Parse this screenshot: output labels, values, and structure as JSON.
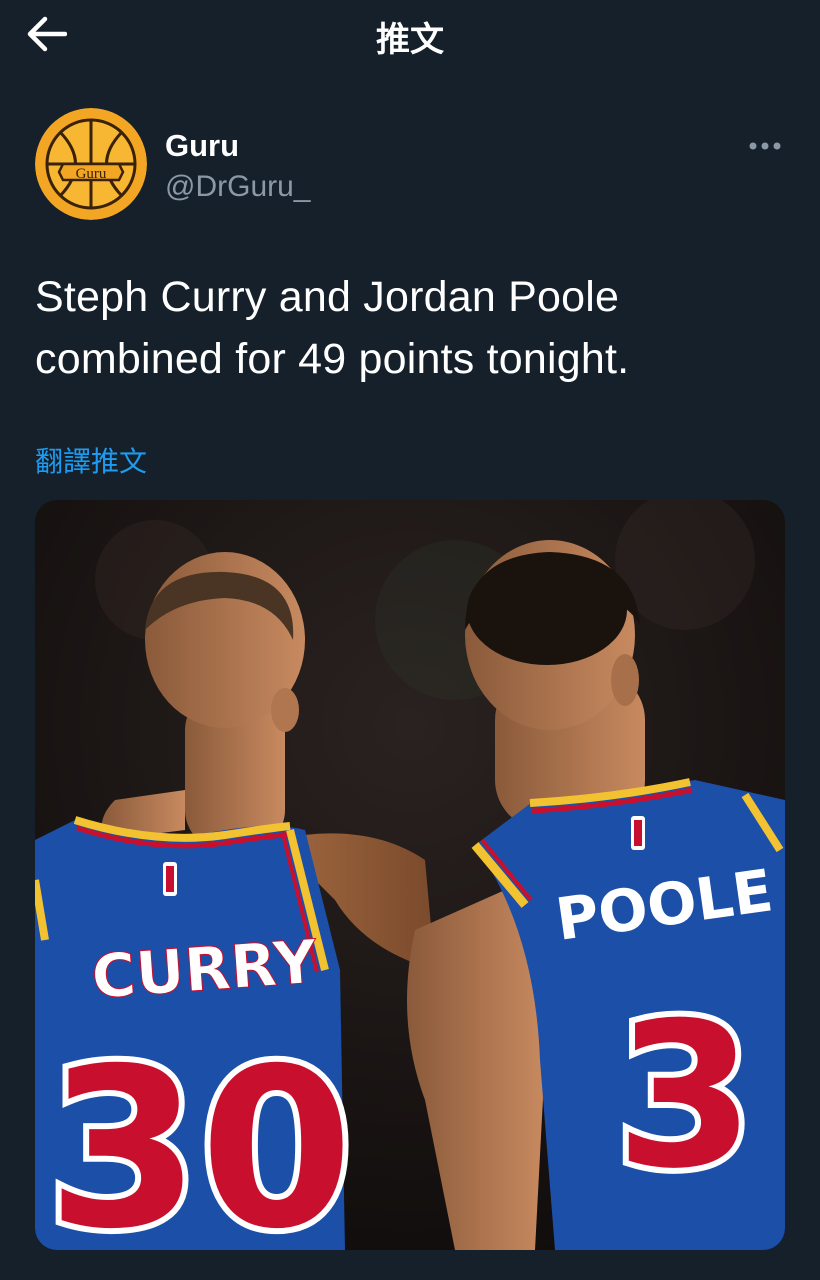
{
  "header": {
    "title": "推文",
    "back_icon": "arrow-left-icon"
  },
  "author": {
    "name": "Guru",
    "handle": "@DrGuru_",
    "avatar_text": "Guru"
  },
  "tweet": {
    "text_line1": "Steph Curry and Jordan Poole",
    "text_line2": "combined for 49 points tonight."
  },
  "translate_label": "翻譯推文",
  "media": {
    "left_player": {
      "name": "CURRY",
      "number": "30"
    },
    "right_player": {
      "name": "POOLE",
      "number": "3"
    }
  },
  "colors": {
    "background": "#15202b",
    "link": "#1d9bf0",
    "secondary_text": "#8b98a5",
    "jersey_blue": "#1c4fa8",
    "jersey_red": "#c8102e",
    "jersey_gold": "#f3c230"
  }
}
